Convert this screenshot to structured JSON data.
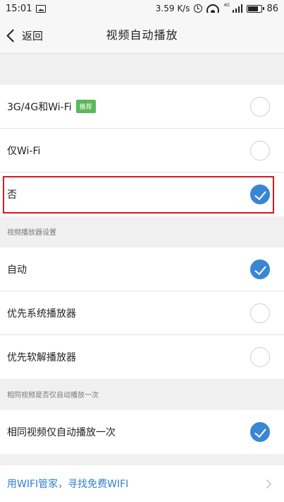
{
  "status_bar": {
    "time": "15:01",
    "speed": "3.59 K/s",
    "network": "4G",
    "battery": "86"
  },
  "nav": {
    "back_label": "返回",
    "title": "视频自动播放"
  },
  "autoplay_options": [
    {
      "label": "3G/4G和Wi-Fi",
      "badge": "推荐",
      "selected": false
    },
    {
      "label": "仅Wi-Fi",
      "selected": false
    },
    {
      "label": "否",
      "selected": true
    }
  ],
  "player_section": {
    "header": "视频播放器设置",
    "options": [
      {
        "label": "自动",
        "selected": true
      },
      {
        "label": "优先系统播放器",
        "selected": false
      },
      {
        "label": "优先软解播放器",
        "selected": false
      }
    ]
  },
  "same_video_section": {
    "header": "相同视频是否仅自动播放一次",
    "options": [
      {
        "label": "相同视频仅自动播放一次",
        "selected": true
      }
    ]
  },
  "promo_link": {
    "label": "用WIFI管家，寻找免费WIFI"
  },
  "colors": {
    "accent": "#3a86d4",
    "highlight_border": "#d9181e",
    "badge": "#5cb85c",
    "link": "#2f7fd1"
  }
}
